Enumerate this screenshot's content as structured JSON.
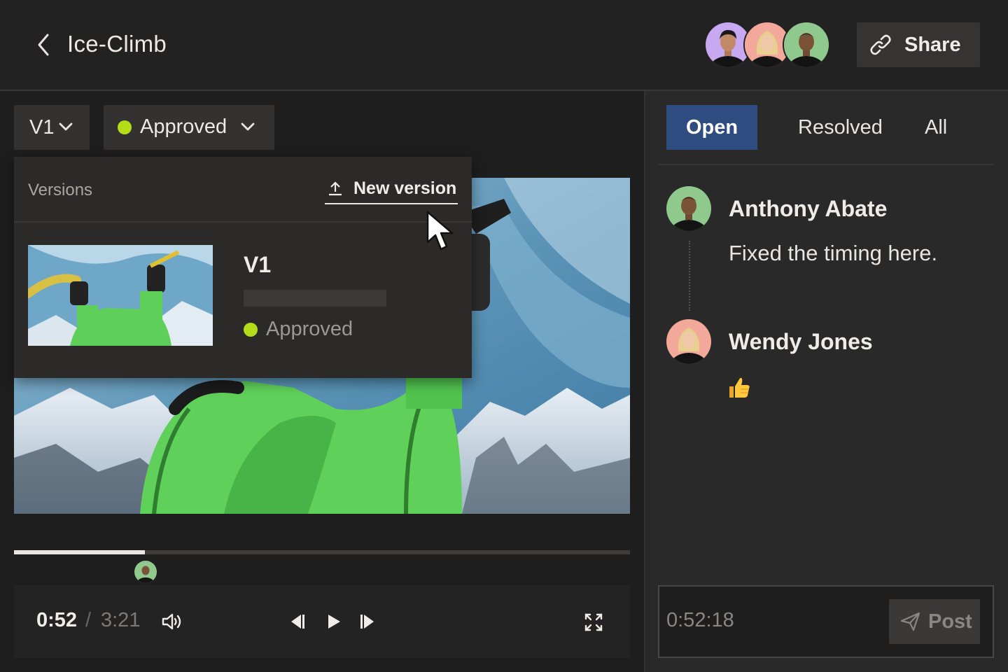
{
  "header": {
    "title": "Ice-Climb",
    "share_label": "Share",
    "collaborators": [
      "collaborator-1",
      "collaborator-2",
      "collaborator-3"
    ]
  },
  "viewer": {
    "version_selector": "V1",
    "status_selector": "Approved",
    "status_color": "#b4dc19",
    "versions_menu": {
      "title": "Versions",
      "new_version_label": "New version",
      "items": [
        {
          "version": "V1",
          "status": "Approved"
        }
      ]
    },
    "playback": {
      "current_time": "0:52",
      "separator": "/",
      "total_time": "3:21",
      "progress_fraction": 0.213
    }
  },
  "comments": {
    "tabs": [
      "Open",
      "Resolved",
      "All"
    ],
    "active_tab": "Open",
    "active_tab_color": "#2f4c80",
    "items": [
      {
        "author": "Anthony Abate",
        "text": "Fixed the timing here."
      },
      {
        "author": "Wendy Jones",
        "text": "👍"
      }
    ],
    "composer": {
      "timestamp": "0:52:18",
      "post_label": "Post"
    }
  },
  "icons": [
    "chevron-left-icon",
    "link-icon",
    "chevron-down-icon",
    "upload-icon",
    "volume-icon",
    "previous-frame-icon",
    "play-icon",
    "next-frame-icon",
    "fullscreen-icon",
    "send-icon",
    "cursor-icon"
  ]
}
